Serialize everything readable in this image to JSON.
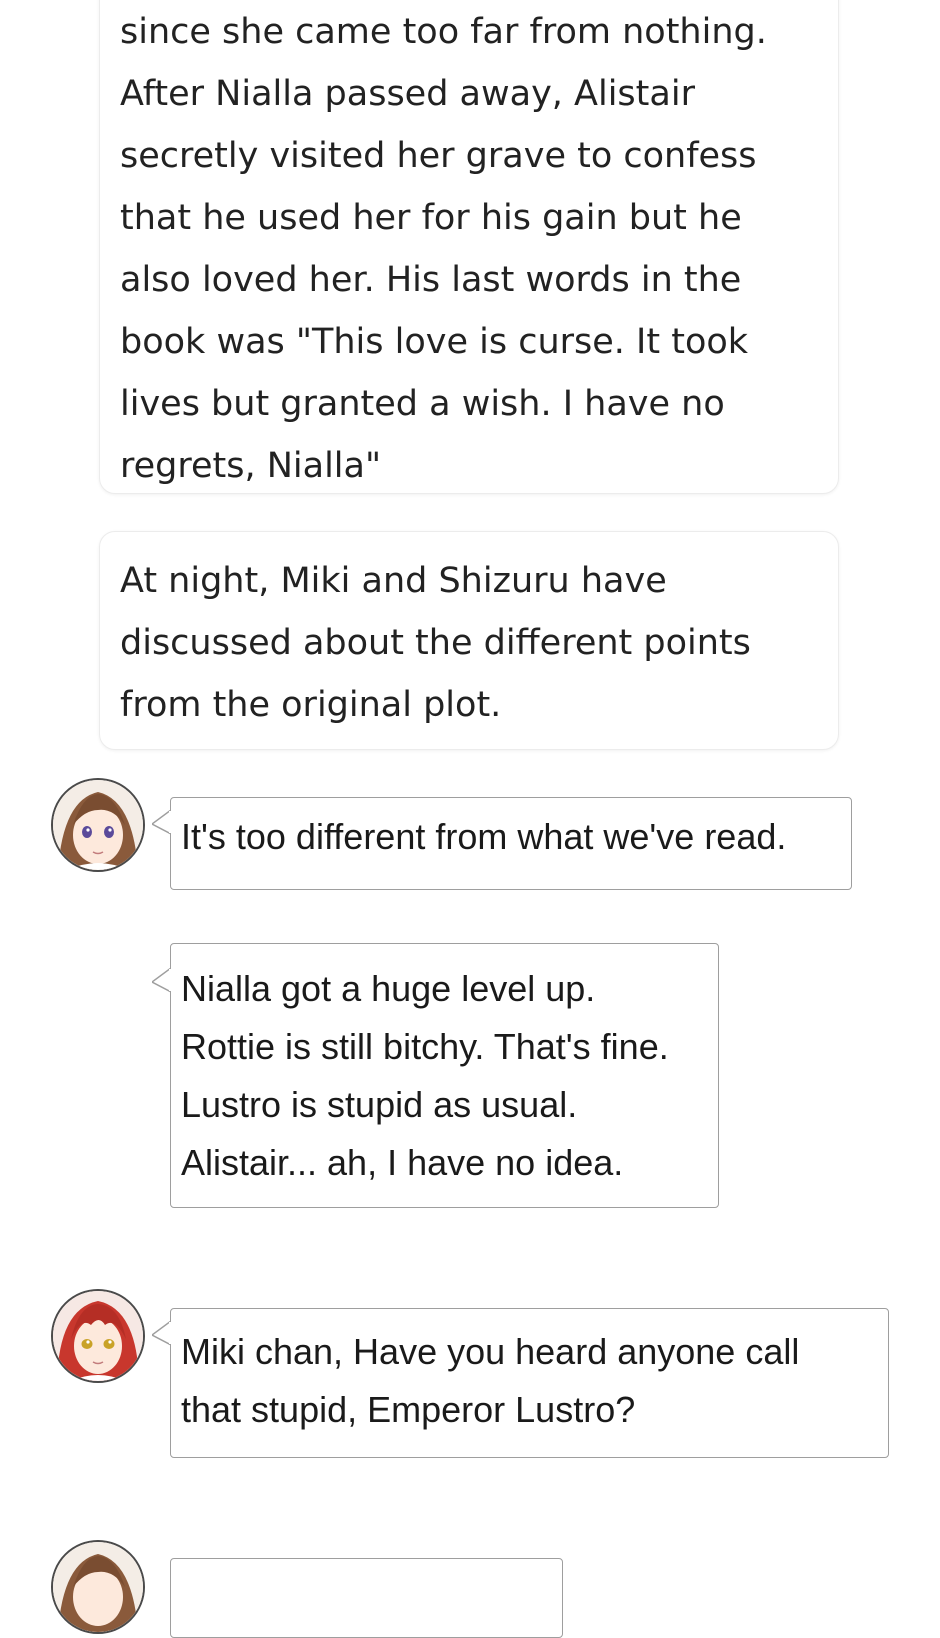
{
  "narration_1": {
    "lines": [
      "since she came too far from nothing.",
      "After Nialla passed away, Alistair",
      "secretly visited her grave to confess",
      "that he used her for his gain but he",
      "also loved her. His last words in the",
      "book was \"This love is curse. It took",
      "lives but granted a wish. I have no",
      "regrets, Nialla\""
    ]
  },
  "narration_2": {
    "lines": [
      "At night, Miki and Shizuru have",
      "discussed about the different points",
      "from the original plot."
    ]
  },
  "messages": [
    {
      "speaker_avatar": "brown-haired-girl-avatar",
      "lines": [
        "It's too different from what we've read."
      ]
    },
    {
      "speaker_avatar": "brown-haired-girl-avatar",
      "lines": [
        "Nialla got a huge level up.",
        "Rottie is still bitchy. That's fine.",
        "Lustro is stupid as usual.",
        "Alistair... ah, I have no idea."
      ]
    },
    {
      "speaker_avatar": "red-haired-girl-avatar",
      "lines": [
        "Miki chan, Have you heard anyone call",
        "that stupid, Emperor Lustro?"
      ]
    }
  ],
  "colors": {
    "brown_hair": "#8a5a3b",
    "red_hair": "#c8372d",
    "bubble_border": "#9e9e9e",
    "card_border": "#ececec"
  }
}
